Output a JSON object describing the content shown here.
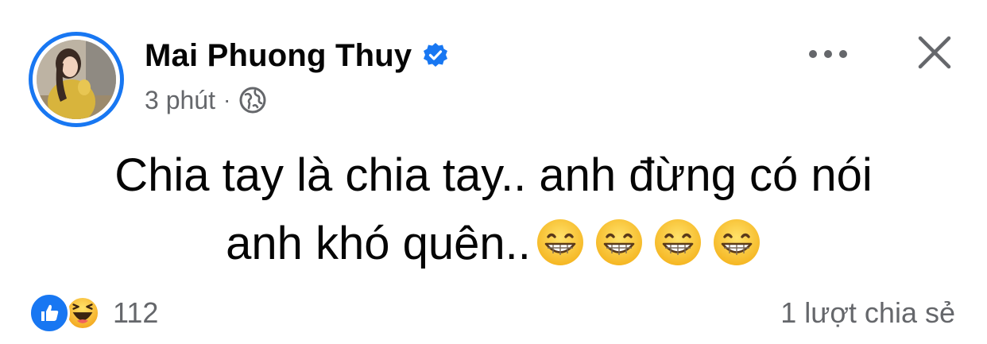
{
  "post": {
    "author": {
      "name": "Mai Phuong Thuy",
      "verified": true,
      "avatar_alt": "profile photo"
    },
    "meta": {
      "time": "3 phút",
      "separator": "·",
      "audience_icon": "globe-icon"
    },
    "actions": {
      "more_icon": "more-horizontal-icon",
      "close_icon": "close-icon"
    },
    "text": {
      "line1": "Chia tay là chia tay.. anh đừng có nói",
      "line2": "anh khó quên..",
      "emoji_count": 4,
      "emoji_name": "grinning-face-with-smiling-eyes"
    },
    "reactions": {
      "types": [
        "like",
        "haha"
      ],
      "count": "112"
    },
    "shares": {
      "label": "1 lượt chia sẻ"
    }
  },
  "colors": {
    "accent": "#1877f2",
    "text_primary": "#050505",
    "text_secondary": "#65676b",
    "background": "#ffffff"
  }
}
